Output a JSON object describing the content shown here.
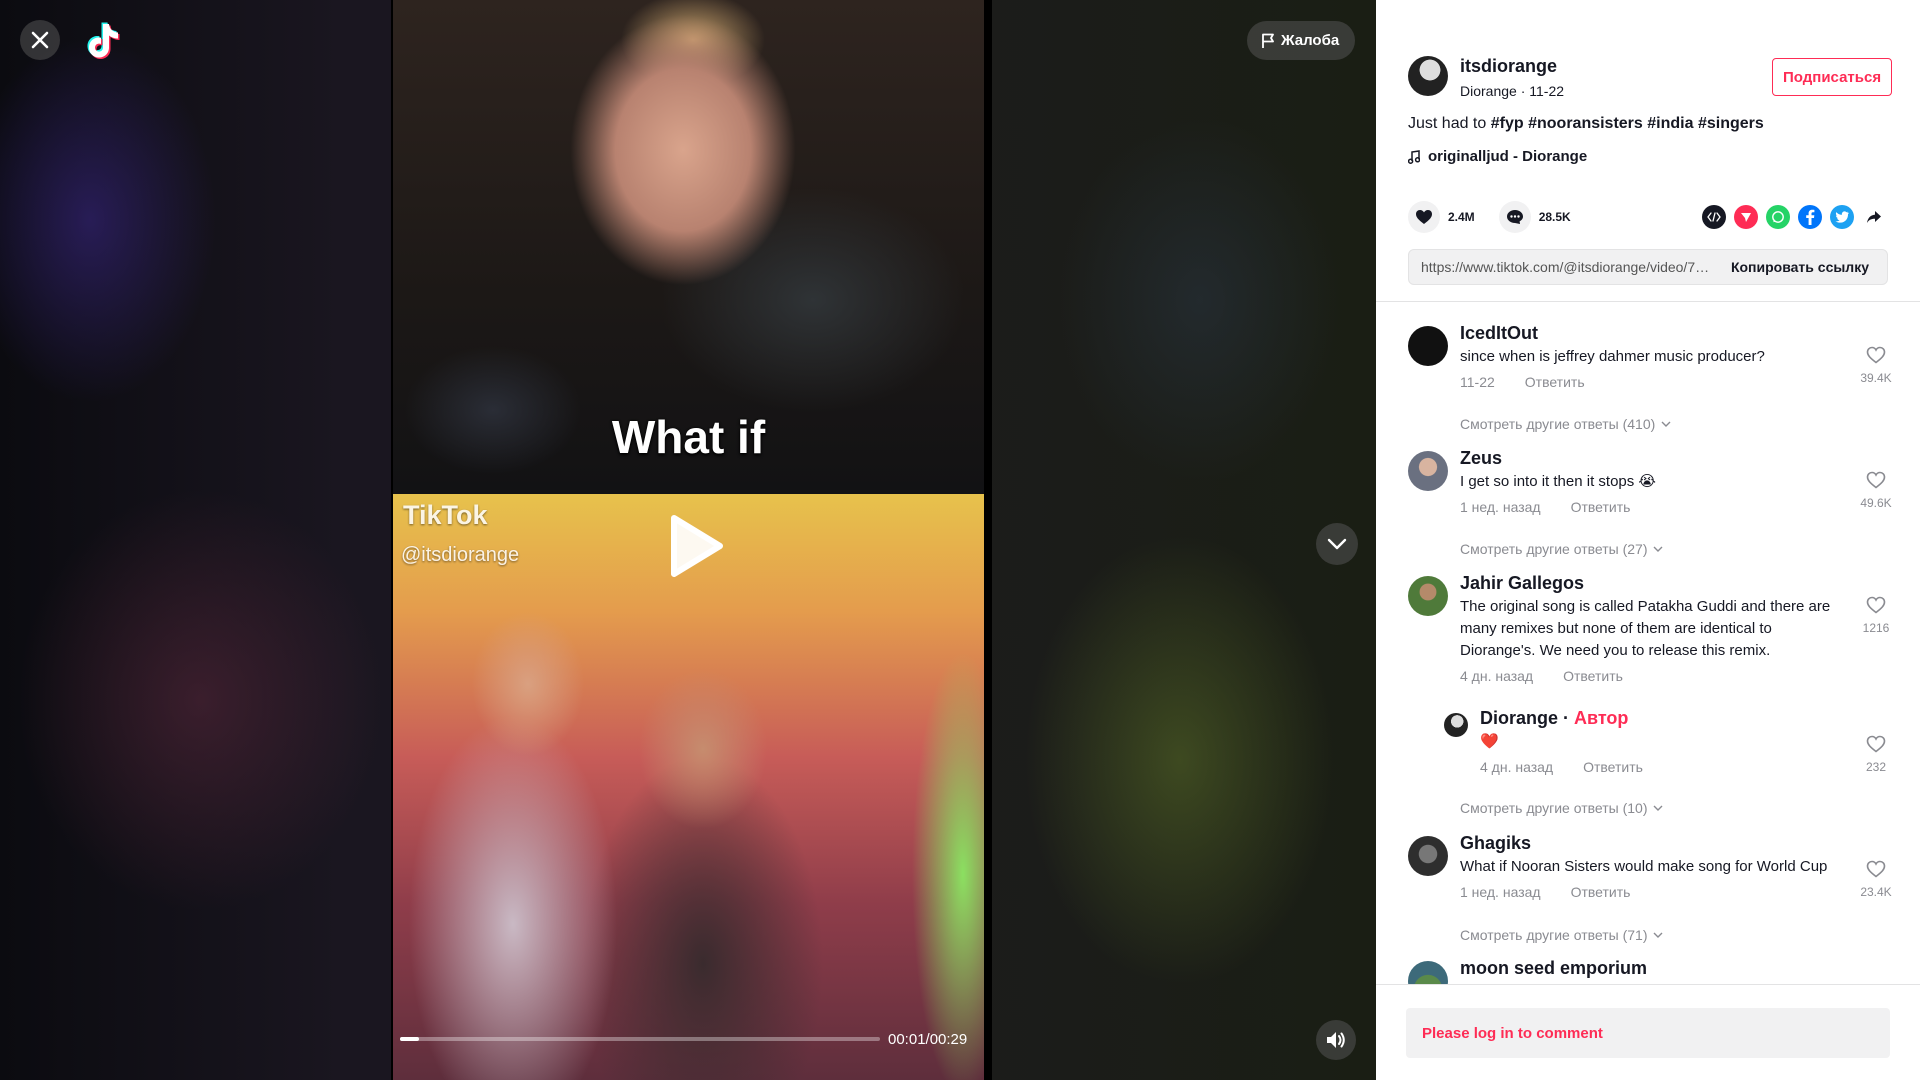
{
  "video": {
    "report_label": "Жалоба",
    "caption_top": "What if",
    "watermark_logo": "TikTok",
    "watermark_handle": "@itsdiorange",
    "time": "00:01/00:29",
    "progress": 0.04
  },
  "post": {
    "username": "itsdiorange",
    "subline": "Diorange · 11-22",
    "follow_label": "Подписаться",
    "desc_text": "Just had to",
    "hashtags": [
      "#fyp",
      "#nooransisters",
      "#india",
      "#singers"
    ],
    "music": "originalljud - Diorange",
    "likes": "2.4M",
    "comments_count": "28.5K",
    "link_url": "https://www.tiktok.com/@itsdiorange/video/71...",
    "copy_label": "Копировать ссылку"
  },
  "comments": [
    {
      "name": "IcedItOut",
      "text": "since when is jeffrey dahmer music producer?",
      "time": "11-22",
      "reply": "Ответить",
      "likes": "39.4K",
      "more": "Смотреть другие ответы (410)"
    },
    {
      "name": "Zeus",
      "text": "I get so into it then it stops 😭",
      "time": "1 нед. назад",
      "reply": "Ответить",
      "likes": "49.6K",
      "more": "Смотреть другие ответы (27)"
    },
    {
      "name": "Jahir Gallegos",
      "text": "The original song is called Patakha Guddi and there are many remixes but none of them are identical to Diorange's. We need you to release this remix.",
      "time": "4 дн. назад",
      "reply": "Ответить",
      "likes": "1216"
    },
    {
      "name": "Ghagiks",
      "text": "What if Nooran Sisters would make song for World Cup",
      "time": "1 нед. назад",
      "reply": "Ответить",
      "likes": "23.4K",
      "more": "Смотреть другие ответы (71)"
    },
    {
      "name": "moon seed emporium"
    }
  ],
  "reply": {
    "name": "Diorange",
    "author_label": "Автор",
    "text": "❤️",
    "time": "4 дн. назад",
    "reply": "Ответить",
    "likes": "232",
    "more": "Смотреть другие ответы (10)"
  },
  "footer": {
    "login_prompt": "Please log in to comment"
  },
  "colors": {
    "accent": "#fe2c55",
    "text": "#161823",
    "muted": "#8a8b91"
  }
}
